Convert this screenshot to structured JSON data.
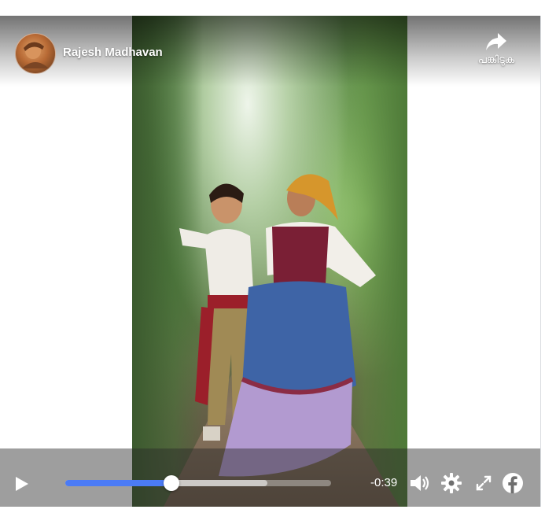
{
  "uploader": {
    "name": "Rajesh Madhavan"
  },
  "share": {
    "label": "പങ്കിടുക"
  },
  "playback": {
    "time_remaining": "-0:39",
    "progress_fraction": 0.4,
    "buffered_fraction": 0.76
  },
  "icons": {
    "play": "play-icon",
    "share": "share-arrow-icon",
    "volume": "volume-icon",
    "settings": "gear-icon",
    "fullscreen": "fullscreen-icon",
    "brand": "facebook-icon"
  },
  "colors": {
    "progress": "#4b7bf5",
    "brand": "#ffffff"
  }
}
